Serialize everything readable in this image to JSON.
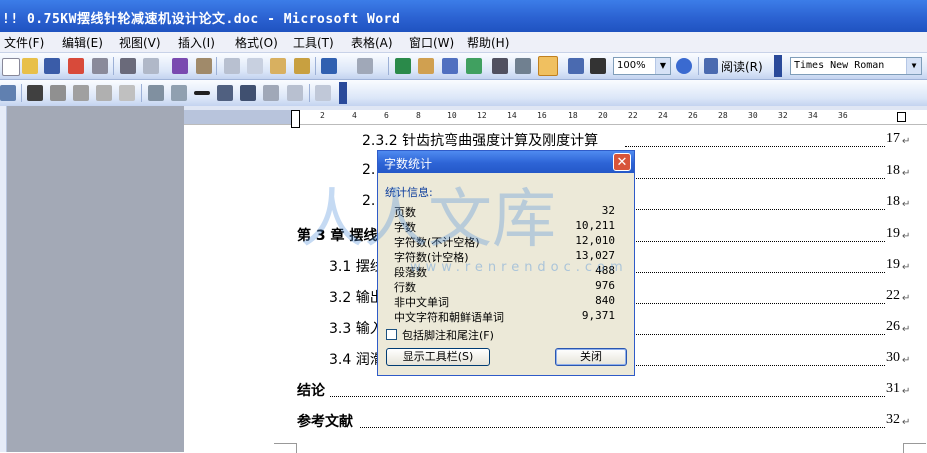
{
  "window": {
    "title": "!! 0.75KW摆线针轮减速机设计论文.doc - Microsoft Word"
  },
  "menu": [
    "文件(F)",
    "编辑(E)",
    "视图(V)",
    "插入(I)",
    "格式(O)",
    "工具(T)",
    "表格(A)",
    "窗口(W)",
    "帮助(H)"
  ],
  "toolbar": {
    "zoom": "100%",
    "read_label": "阅读(R)",
    "font": "Times New Roman"
  },
  "ruler": [
    "6",
    "4",
    "2",
    "2",
    "4",
    "6",
    "8",
    "10",
    "12",
    "14",
    "16",
    "18",
    "20",
    "22",
    "24",
    "26",
    "28",
    "30",
    "32",
    "34",
    "36"
  ],
  "toc": [
    {
      "text": "2.3.2  针齿抗弯曲强度计算及刚度计算",
      "page": "17"
    },
    {
      "text": "2.",
      "page": "18"
    },
    {
      "text": "2.",
      "page": "18"
    },
    {
      "text": "第 3 章  摆线",
      "page": "19"
    },
    {
      "text": "3.1  摆线",
      "page": "19"
    },
    {
      "text": "3.2  输出",
      "page": "22"
    },
    {
      "text": "3.3  输入",
      "page": "26"
    },
    {
      "text": "3.4  润滑",
      "page": "30"
    },
    {
      "text": "结论",
      "page": "31"
    },
    {
      "text": "参考文献",
      "page": "32"
    }
  ],
  "dialog": {
    "title": "字数统计",
    "group_label": "统计信息:",
    "stats": [
      {
        "label": "页数",
        "value": "32"
      },
      {
        "label": "字数",
        "value": "10,211"
      },
      {
        "label": "字符数(不计空格)",
        "value": "12,010"
      },
      {
        "label": "字符数(计空格)",
        "value": "13,027"
      },
      {
        "label": "段落数",
        "value": "488"
      },
      {
        "label": "行数",
        "value": "976"
      },
      {
        "label": "非中文单词",
        "value": "840"
      },
      {
        "label": "中文字符和朝鲜语单词",
        "value": "9,371"
      }
    ],
    "checkbox_label": "包括脚注和尾注(F)",
    "show_toolbar_button": "显示工具栏(S)",
    "close_button": "关闭",
    "close_icon": "close-icon"
  },
  "watermark": {
    "main": "人人文库",
    "sub": "www.renrendoc.com"
  },
  "colors": {
    "titlebar": "#2a60d0",
    "dialog_bg": "#ece9d8",
    "page_gray": "#a3a9b6"
  }
}
